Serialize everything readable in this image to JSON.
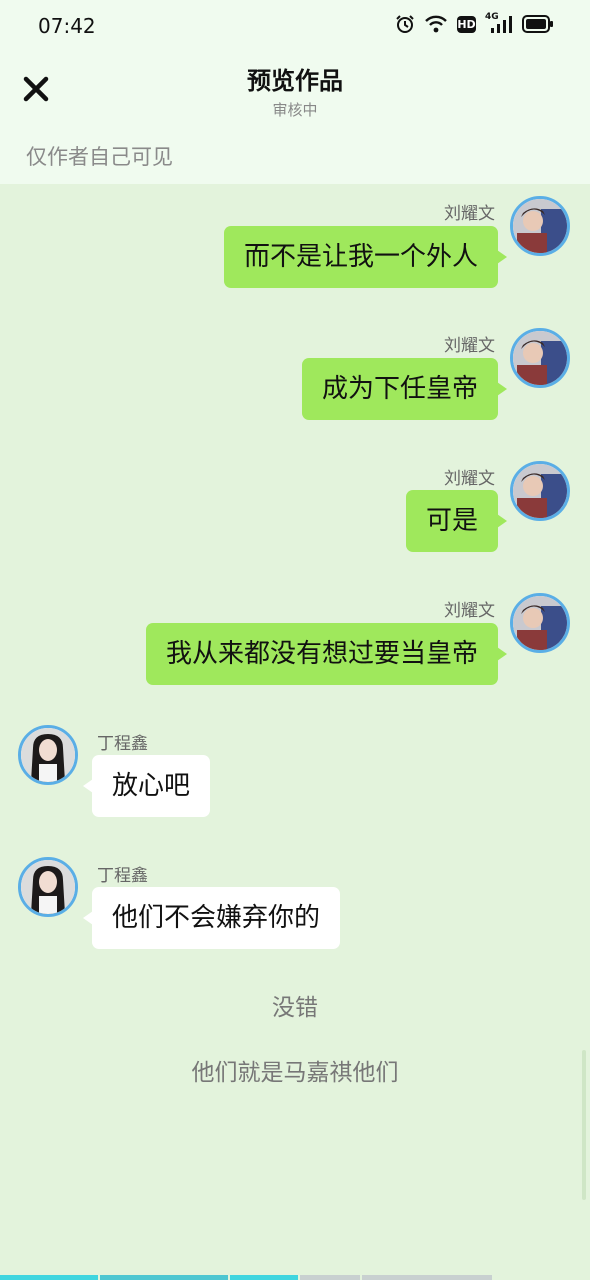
{
  "status_bar": {
    "time": "07:42",
    "network": "4G",
    "hd": "HD"
  },
  "header": {
    "title": "预览作品",
    "subtitle": "审核中",
    "visibility_note": "仅作者自己可见"
  },
  "messages": [
    {
      "side": "right",
      "speaker": "刘耀文",
      "text": "而不是让我一个外人"
    },
    {
      "side": "right",
      "speaker": "刘耀文",
      "text": "成为下任皇帝"
    },
    {
      "side": "right",
      "speaker": "刘耀文",
      "text": "可是"
    },
    {
      "side": "right",
      "speaker": "刘耀文",
      "text": "我从来都没有想过要当皇帝"
    },
    {
      "side": "left",
      "speaker": "丁程鑫",
      "text": "放心吧"
    },
    {
      "side": "left",
      "speaker": "丁程鑫",
      "text": "他们不会嫌弃你的"
    }
  ],
  "narration": [
    "没错",
    "他们就是马嘉祺他们"
  ],
  "colors": {
    "right_bubble": "#9fe85c",
    "left_bubble": "#ffffff",
    "chat_background": "#e3f3dc",
    "header_background": "#f0fbef",
    "avatar_ring": "#5aaee6"
  }
}
